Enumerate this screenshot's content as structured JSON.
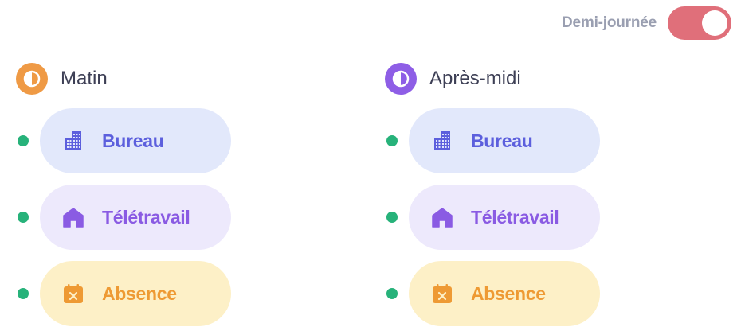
{
  "toggle": {
    "label": "Demi-journée",
    "on": true
  },
  "colors": {
    "green_dot": "#27b27a",
    "office": "#5c5fdd",
    "remote": "#8a5be3",
    "absence": "#ee9a34",
    "morning": "#ef9a45",
    "afternoon": "#8e5ee6",
    "toggle_on": "#e06f7a"
  },
  "morning": {
    "title": "Matin",
    "icon": "half-circle-icon",
    "options": [
      {
        "label": "Bureau",
        "icon": "building-icon"
      },
      {
        "label": "Télétravail",
        "icon": "house-icon"
      },
      {
        "label": "Absence",
        "icon": "calendar-x-icon"
      }
    ]
  },
  "afternoon": {
    "title": "Après-midi",
    "icon": "half-circle-icon",
    "options": [
      {
        "label": "Bureau",
        "icon": "building-icon"
      },
      {
        "label": "Télétravail",
        "icon": "house-icon"
      },
      {
        "label": "Absence",
        "icon": "calendar-x-icon"
      }
    ]
  }
}
